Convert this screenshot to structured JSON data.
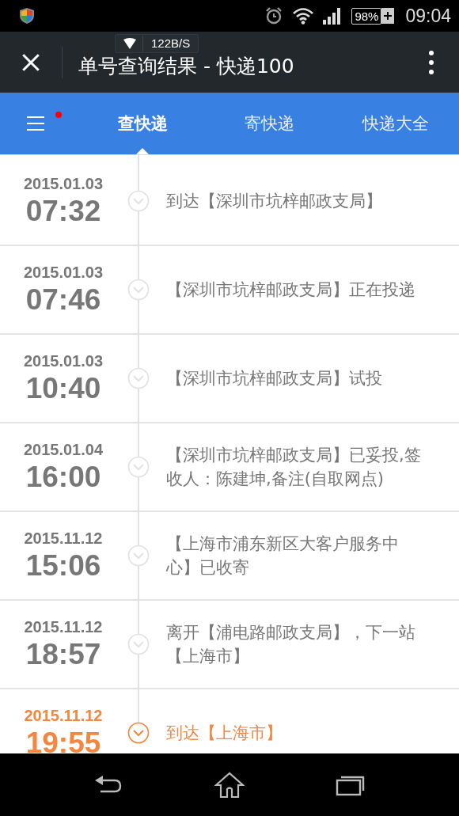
{
  "status_bar": {
    "battery": "98%",
    "time": "09:04"
  },
  "speed_overlay": {
    "text": "122B/S"
  },
  "title_bar": {
    "title": "单号查询结果 - 快递100"
  },
  "nav": {
    "menu_badge": true,
    "tabs": [
      {
        "label": "查快递",
        "selected": true
      },
      {
        "label": "寄快递",
        "selected": false
      },
      {
        "label": "快递大全",
        "selected": false
      }
    ]
  },
  "tracking": [
    {
      "date": "2015.01.03",
      "time": "07:32",
      "text": "到达【深圳市坑梓邮政支局】",
      "current": false
    },
    {
      "date": "2015.01.03",
      "time": "07:46",
      "text": "【深圳市坑梓邮政支局】正在投递",
      "current": false
    },
    {
      "date": "2015.01.03",
      "time": "10:40",
      "text": "【深圳市坑梓邮政支局】试投",
      "current": false
    },
    {
      "date": "2015.01.04",
      "time": "16:00",
      "text": "【深圳市坑梓邮政支局】已妥投,签收人：陈建坤,备注(自取网点)",
      "current": false
    },
    {
      "date": "2015.11.12",
      "time": "15:06",
      "text": "【上海市浦东新区大客户服务中心】已收寄",
      "current": false
    },
    {
      "date": "2015.11.12",
      "time": "18:57",
      "text": "离开【浦电路邮政支局】，下一站【上海市】",
      "current": false
    },
    {
      "date": "2015.11.12",
      "time": "19:55",
      "text": "到达【上海市】",
      "current": true
    }
  ]
}
